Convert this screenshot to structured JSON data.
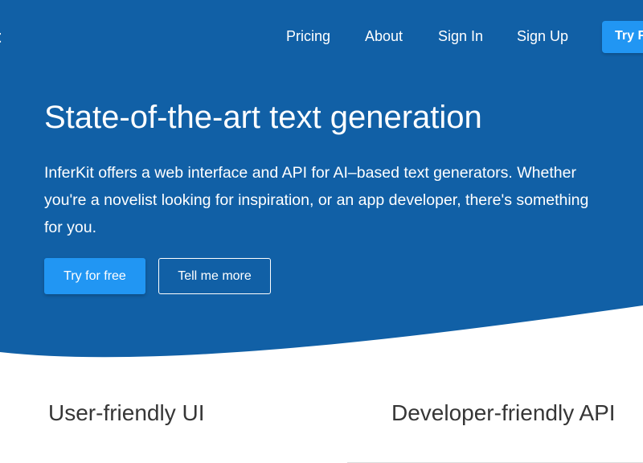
{
  "brand": {
    "name": "t"
  },
  "nav": {
    "links": [
      "Pricing",
      "About",
      "Sign In",
      "Sign Up"
    ],
    "cta_label": "Try F"
  },
  "hero": {
    "title": "State-of-the-art text generation",
    "description": "InferKit offers a web interface and API for AI–based text generators. Whether you're a novelist looking for inspiration, or an app developer, there's something for you.",
    "primary_button": "Try for free",
    "secondary_button": "Tell me more"
  },
  "features": [
    {
      "title": "User-friendly UI"
    },
    {
      "title": "Developer-friendly API"
    }
  ],
  "colors": {
    "hero_bg": "#1160a6",
    "accent": "#2196f3",
    "heading_text": "#363636"
  }
}
